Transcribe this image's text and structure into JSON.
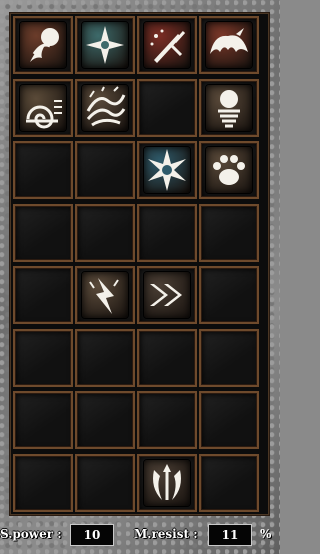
{
  "skills": [
    {
      "row": 0,
      "col": 0,
      "icon": "fireball-icon",
      "bg": "#6b3c2a"
    },
    {
      "row": 0,
      "col": 1,
      "icon": "shuriken-icon",
      "bg": "#3d6a6a"
    },
    {
      "row": 0,
      "col": 2,
      "icon": "sword-sparkle-icon",
      "bg": "#7a2d24"
    },
    {
      "row": 0,
      "col": 3,
      "icon": "bat-wings-icon",
      "bg": "#7a3728"
    },
    {
      "row": 1,
      "col": 0,
      "icon": "snail-spiral-icon",
      "bg": "#5a4a38"
    },
    {
      "row": 1,
      "col": 1,
      "icon": "spiked-wave-icon",
      "bg": "#5a4a3a"
    },
    {
      "row": 1,
      "col": 3,
      "icon": "orb-pillar-icon",
      "bg": "#5a4a3a"
    },
    {
      "row": 2,
      "col": 2,
      "icon": "ice-star-icon",
      "bg": "#2e5a6a"
    },
    {
      "row": 2,
      "col": 3,
      "icon": "paw-print-icon",
      "bg": "#5a4a3a"
    },
    {
      "row": 4,
      "col": 1,
      "icon": "lightning-hand-icon",
      "bg": "#5a4a3a"
    },
    {
      "row": 4,
      "col": 2,
      "icon": "double-arrow-icon",
      "bg": "#4a3e34"
    },
    {
      "row": 7,
      "col": 2,
      "icon": "tribal-horns-icon",
      "bg": "#4a3e34"
    }
  ],
  "stats": {
    "power_label": "S.power :",
    "power_value": "10",
    "resist_label": "M.resist :",
    "resist_value": "11",
    "percent": "%"
  }
}
